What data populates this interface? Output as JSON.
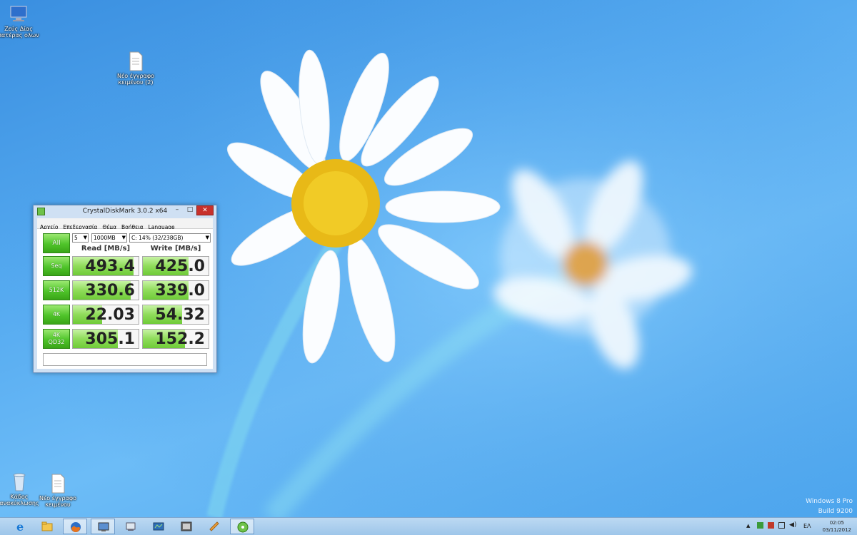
{
  "desktop": {
    "icons": [
      {
        "label": "Ζεύς Δίας πατέρας ολων",
        "icon": "computer-icon"
      },
      {
        "label": "Νέο έγγραφο κειμένου (2)",
        "icon": "text-document-icon"
      },
      {
        "label": "Κάδος ανακύκλωσης",
        "icon": "recycle-bin-icon"
      },
      {
        "label": "Νέο έγγραφο κειμένου",
        "icon": "text-document-icon"
      }
    ]
  },
  "window": {
    "title": "CrystalDiskMark 3.0.2 x64",
    "controls": {
      "minimize": "–",
      "maximize": "□",
      "close": "✕"
    },
    "menu": [
      "Αρχείο",
      "Επεξεργασία",
      "Θέμα",
      "Βοήθεια",
      "Language"
    ],
    "all_label": "All",
    "count": "5",
    "size": "1000MB",
    "drive": "C: 14% (32/238GB)",
    "read_header": "Read [MB/s]",
    "write_header": "Write [MB/s]",
    "rows": [
      {
        "label": "Seq",
        "sub": "",
        "read": "493.4",
        "write": "425.0"
      },
      {
        "label": "512K",
        "sub": "",
        "read": "330.6",
        "write": "339.0"
      },
      {
        "label": "4K",
        "sub": "",
        "read": "22.03",
        "write": "54.32"
      },
      {
        "label": "4K",
        "sub": "QD32",
        "read": "305.1",
        "write": "152.2"
      }
    ],
    "status": ""
  },
  "watermark": {
    "line1": "Windows 8 Pro",
    "line2": "Build 9200"
  },
  "taskbar": {
    "apps": [
      "internet-explorer-icon",
      "file-explorer-icon",
      "firefox-icon",
      "remote-desktop-icon",
      "device-manager-icon",
      "task-manager-icon",
      "media-icon",
      "paint-icon",
      "crystaldiskmark-icon"
    ],
    "language": "ΕΛ",
    "time": "02:05",
    "date": "03/11/2012"
  },
  "colors": {
    "accent_green": "#4fc42a",
    "close_red": "#c7312b",
    "taskbar": "#b0d0ee"
  }
}
